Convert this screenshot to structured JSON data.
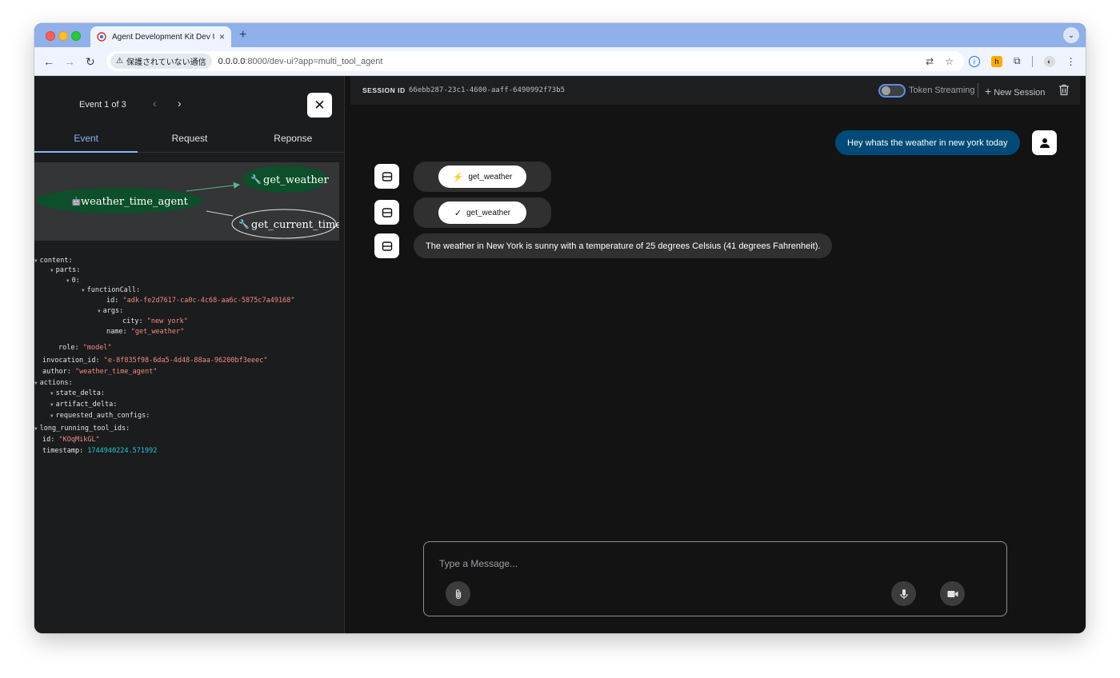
{
  "browser": {
    "tab_title": "Agent Development Kit Dev UI",
    "tab_close": "×",
    "new_tab": "+",
    "not_secure": "保護されていない通信",
    "url_host": "0.0.0.0",
    "url_rest": ":8000/dev-ui?app=multi_tool_agent"
  },
  "event_panel": {
    "event_counter": "Event 1 of 3",
    "close_label": "✕",
    "tabs": [
      "Event",
      "Request",
      "Reponse"
    ],
    "active_tab": "Event",
    "graph": {
      "agent_node": "weather_time_agent",
      "tool_nodes": [
        "get_weather",
        "get_current_time"
      ]
    },
    "tree": {
      "content": "content",
      "parts": "parts",
      "index": "0",
      "functionCall": "functionCall",
      "id_key": "id",
      "id_val": "\"adk-fe2d7617-ca0c-4c68-aa6c-5875c7a49168\"",
      "args": "args",
      "city_key": "city",
      "city_val": "\"new york\"",
      "name_key": "name",
      "name_val": "\"get_weather\"",
      "role_key": "role",
      "role_val": "\"model\"",
      "invocation_key": "invocation_id",
      "invocation_val": "\"e-8f835f98-6da5-4d48-88aa-96200bf3eeec\"",
      "author_key": "author",
      "author_val": "\"weather_time_agent\"",
      "actions": "actions",
      "state_delta": "state_delta",
      "artifact_delta": "artifact_delta",
      "requested_auth_configs": "requested_auth_configs",
      "long_running": "long_running_tool_ids",
      "event_id_key": "id",
      "event_id_val": "\"KOqMikGL\"",
      "timestamp_key": "timestamp",
      "timestamp_val": "1744940224.571992"
    }
  },
  "session": {
    "label": "SESSION ID",
    "id": "66ebb287-23c1-4600-aaff-6490992f73b5",
    "token_streaming": "Token Streaming",
    "new_session": "New Session"
  },
  "chat": {
    "user_message": "Hey whats the weather in new york today",
    "function_call": "get_weather",
    "function_response": "get_weather",
    "bot_reply": "The weather in New York is sunny with a temperature of 25 degrees Celsius (41 degrees Fahrenheit).",
    "input_placeholder": "Type a Message..."
  },
  "colors": {
    "user_bubble": "#004a77",
    "active_tab": "#8ab4f8",
    "graph_node_active": "#0d4f2a",
    "string_value": "#f28b82",
    "number_value": "#26c6da"
  }
}
